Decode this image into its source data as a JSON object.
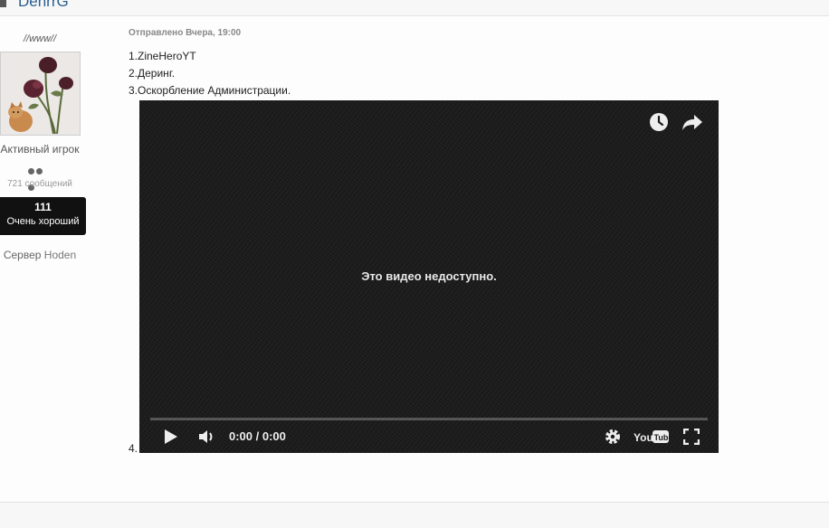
{
  "thread": {
    "title": "DenrrG"
  },
  "author": {
    "username": "//www//",
    "title": "Активный игрок",
    "message_count": "721 сообщений",
    "reputation_value": "111",
    "reputation_label": "Очень хороший",
    "server_label": "Сервер",
    "server_name": "Hoden"
  },
  "post": {
    "meta": "Отправлено Вчера, 19:00",
    "lines": [
      "1.ZineHeroYT",
      "2.Деринг.",
      "3.Оскорбление Администрации.",
      "4."
    ]
  },
  "video": {
    "unavailable_text": "Это видео недоступно.",
    "time": "0:00 / 0:00",
    "progress": 0,
    "icons": {
      "watch_later": "clock-icon",
      "share": "share-icon",
      "play": "play-icon",
      "volume": "volume-icon",
      "settings": "gear-icon",
      "logo": "youtube-logo",
      "fullscreen": "fullscreen-icon"
    }
  },
  "colors": {
    "rep_box": "#111111",
    "link": "#2a5f8f",
    "video_bg": "#1a1a1a"
  }
}
